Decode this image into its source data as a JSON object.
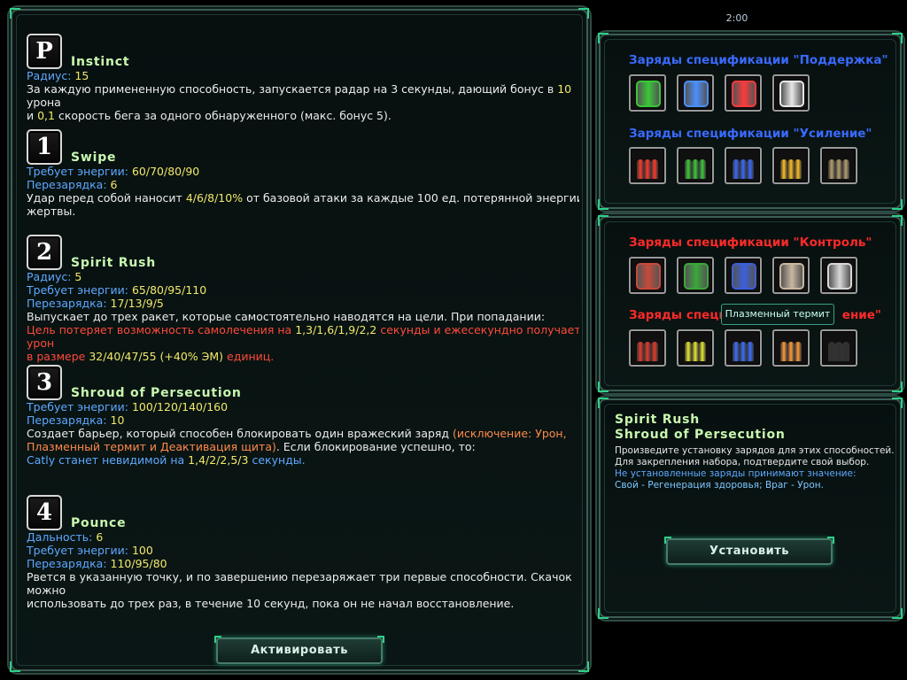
{
  "timer": "2:00",
  "abilities": [
    {
      "key": "P",
      "name": "Instinct",
      "lines": [
        [
          [
            "lbl",
            "Радиус: "
          ],
          [
            "val",
            "15"
          ]
        ],
        [
          [
            "txt",
            "За каждую примененную способность, запускается радар на 3 секунды, дающий бонус в "
          ],
          [
            "val",
            "10"
          ],
          [
            "txt",
            " урона"
          ]
        ],
        [
          [
            "txt",
            "и "
          ],
          [
            "val",
            "0,1"
          ],
          [
            "txt",
            " скорость бега за одного обнаруженного (макс. бонус 5)."
          ]
        ]
      ]
    },
    {
      "key": "1",
      "name": "Swipe",
      "lines": [
        [
          [
            "lbl",
            "Требует энергии: "
          ],
          [
            "val",
            "60/70/80/90"
          ]
        ],
        [
          [
            "lbl",
            "Перезарядка: "
          ],
          [
            "val",
            "6"
          ]
        ],
        [
          [
            "txt",
            "Удар перед собой наносит "
          ],
          [
            "val",
            "4/6/8/10%"
          ],
          [
            "txt",
            " от базовой атаки за каждые 100 ед. потерянной энергии"
          ]
        ],
        [
          [
            "txt",
            "жертвы."
          ]
        ]
      ]
    },
    {
      "key": "2",
      "name": "Spirit Rush",
      "lines": [
        [
          [
            "lbl",
            "Радиус: "
          ],
          [
            "val",
            "5"
          ]
        ],
        [
          [
            "lbl",
            "Требует энергии: "
          ],
          [
            "val",
            "65/80/95/110"
          ]
        ],
        [
          [
            "lbl",
            "Перезарядка: "
          ],
          [
            "val",
            "17/13/9/5"
          ]
        ],
        [
          [
            "txt",
            "Выпускает до трех ракет, которые самостоятельно наводятся на цели. При попадании:"
          ]
        ],
        [
          [
            "red",
            "Цель потеряет возможность самолечения на "
          ],
          [
            "val",
            "1,3/1,6/1,9/2,2"
          ],
          [
            "red",
            " секунды и ежесекундно получает урон"
          ]
        ],
        [
          [
            "red",
            "в размере "
          ],
          [
            "val",
            "32/40/47/55 (+40% ЭМ)"
          ],
          [
            "red",
            " единиц."
          ]
        ]
      ]
    },
    {
      "key": "3",
      "name": "Shroud of Persecution",
      "lines": [
        [
          [
            "lbl",
            "Требует энергии: "
          ],
          [
            "val",
            "100/120/140/160"
          ]
        ],
        [
          [
            "lbl",
            "Перезарядка: "
          ],
          [
            "val",
            "10"
          ]
        ],
        [
          [
            "txt",
            "Создает барьер, который способен блокировать один вражеский заряд "
          ],
          [
            "org",
            "(исключение: Урон,"
          ]
        ],
        [
          [
            "org",
            "Плазменный термит и Деактивация щита)"
          ],
          [
            "txt",
            ". Если блокирование успешно, то:"
          ]
        ],
        [
          [
            "blu",
            "Catly станет невидимой на "
          ],
          [
            "val",
            "1,4/2/2,5/3"
          ],
          [
            "blu",
            " секунды."
          ]
        ]
      ]
    },
    {
      "key": "4",
      "name": "Pounce",
      "lines": [
        [
          [
            "lbl",
            "Дальность: "
          ],
          [
            "val",
            "6"
          ]
        ],
        [
          [
            "lbl",
            "Требует энергии: "
          ],
          [
            "val",
            "100"
          ]
        ],
        [
          [
            "lbl",
            "Перезарядка: "
          ],
          [
            "val",
            "110/95/80"
          ]
        ],
        [
          [
            "txt",
            "Рвется в указанную точку, и по завершению перезаряжает три первые способности. Скачок можно"
          ]
        ],
        [
          [
            "txt",
            "использовать до трех раз, в течение 10 секунд, пока он не начал восстановление."
          ]
        ]
      ]
    }
  ],
  "activate_label": "Активировать",
  "panels": {
    "support_title": "Заряды спецификации \"Поддержка\"",
    "boost_title": "Заряды спецификации \"Усиление\"",
    "control_title": "Заряды спецификации \"Контроль\"",
    "damage_title_visible": "Заряды специ",
    "damage_title_tail": "ение\""
  },
  "icons": {
    "support": [
      "#38c838",
      "#4a90ff",
      "#ff3a3a",
      "#e8e8e8"
    ],
    "boost": [
      "#ff3a2a",
      "#3acc3a",
      "#3a6aff",
      "#ffc020",
      "#b8a070"
    ],
    "control": [
      "#c84a3a",
      "#3aa83a",
      "#3a60e0",
      "#c8b8a0",
      "#d8d8d8"
    ],
    "damage": [
      "#e83a2a",
      "#e8e830",
      "#3a70ff",
      "#ff9a3a",
      "#303030"
    ]
  },
  "tooltip": "Плазменный термит",
  "info": {
    "title1": "Spirit Rush",
    "title2": "Shroud of Persecution",
    "desc1": "Произведите установку зарядов для этих способностей.",
    "desc2": "Для закрепления набора, подтвердите свой выбор.",
    "desc3": "Не установленные заряды принимают значение:",
    "desc4": "Свой - Регенерация здоровья; Враг - Урон.",
    "install_label": "Установить"
  },
  "colors": {
    "accent": "#2fd08a",
    "support_title": "#3a6aff",
    "control_title": "#ff2a2a",
    "label": "#5fa8ff",
    "value": "#f2e86a"
  }
}
